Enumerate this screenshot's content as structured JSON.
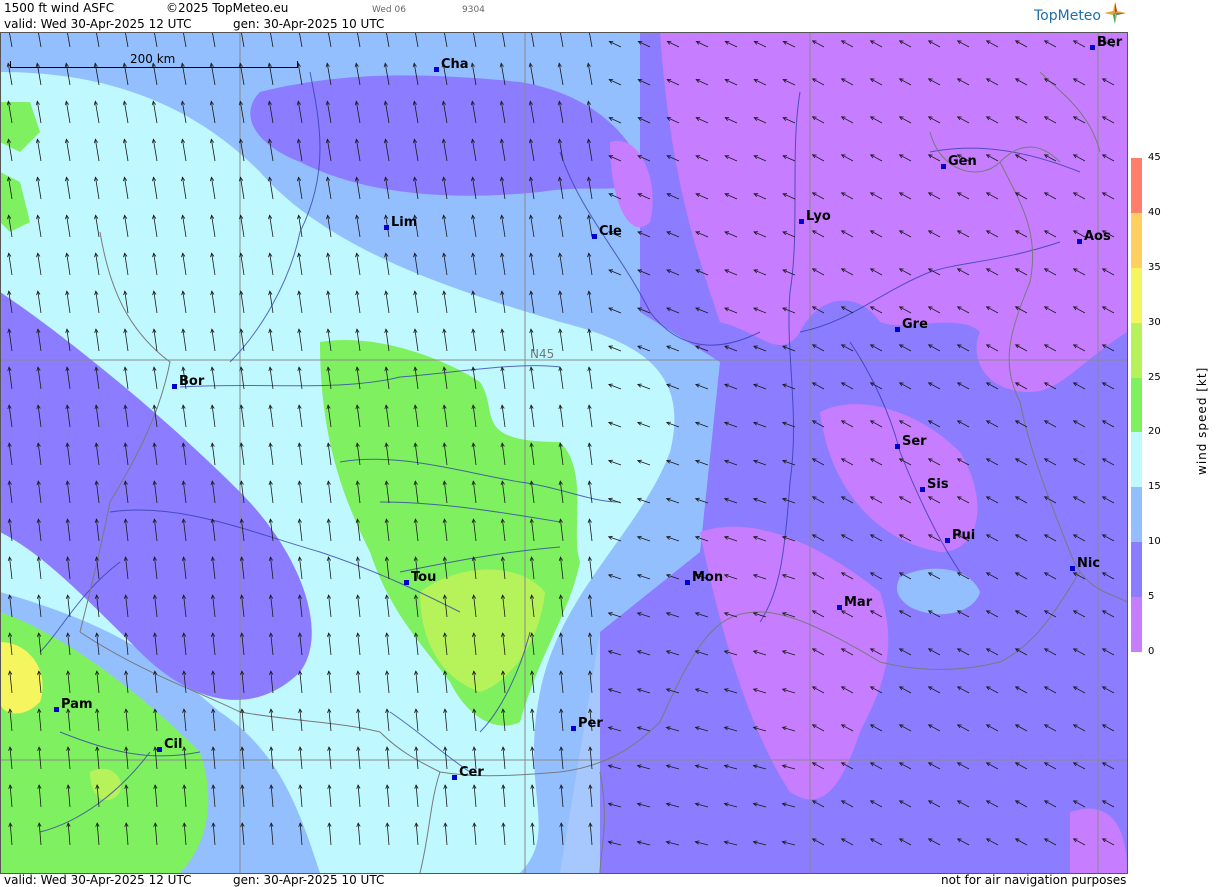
{
  "header": {
    "product": "1500 ft wind ASFC",
    "copyright": "©2025 TopMeteo.eu",
    "day_code": "Wed 06",
    "code": "9304",
    "valid": "valid:  Wed  30-Apr-2025  12 UTC",
    "generated": "gen: 30-Apr-2025 10 UTC"
  },
  "footer": {
    "valid": "valid:  Wed  30-Apr-2025  12 UTC",
    "generated": "gen: 30-Apr-2025 10 UTC",
    "disclaimer": "not for air navigation purposes"
  },
  "logo": {
    "text": "TopMeteo"
  },
  "scale_bar": {
    "label": "200 km"
  },
  "graticule": {
    "latitude_label": "N45"
  },
  "cities": [
    {
      "name": "Cha"
    },
    {
      "name": "Lim"
    },
    {
      "name": "Cle"
    },
    {
      "name": "Lyo"
    },
    {
      "name": "Gen"
    },
    {
      "name": "Ber"
    },
    {
      "name": "Aos"
    },
    {
      "name": "Gre"
    },
    {
      "name": "Bor"
    },
    {
      "name": "Ser"
    },
    {
      "name": "Sis"
    },
    {
      "name": "Pui"
    },
    {
      "name": "Nic"
    },
    {
      "name": "Tou"
    },
    {
      "name": "Mon"
    },
    {
      "name": "Mar"
    },
    {
      "name": "Pam"
    },
    {
      "name": "Cil"
    },
    {
      "name": "Per"
    },
    {
      "name": "Cer"
    }
  ],
  "legend": {
    "title": "wind speed [kt]",
    "ticks": [
      "45",
      "40",
      "35",
      "30",
      "25",
      "20",
      "15",
      "10",
      "5",
      "0"
    ],
    "bands": [
      {
        "from": 0,
        "to": 5,
        "color": "#c77dff"
      },
      {
        "from": 5,
        "to": 10,
        "color": "#8c7cff"
      },
      {
        "from": 10,
        "to": 15,
        "color": "#93bfff"
      },
      {
        "from": 15,
        "to": 20,
        "color": "#bff8ff"
      },
      {
        "from": 20,
        "to": 25,
        "color": "#7ff05f"
      },
      {
        "from": 25,
        "to": 30,
        "color": "#b6f25a"
      },
      {
        "from": 30,
        "to": 35,
        "color": "#f5f560"
      },
      {
        "from": 35,
        "to": 40,
        "color": "#ffd060"
      },
      {
        "from": 40,
        "to": 45,
        "color": "#ff7f6a"
      }
    ]
  }
}
